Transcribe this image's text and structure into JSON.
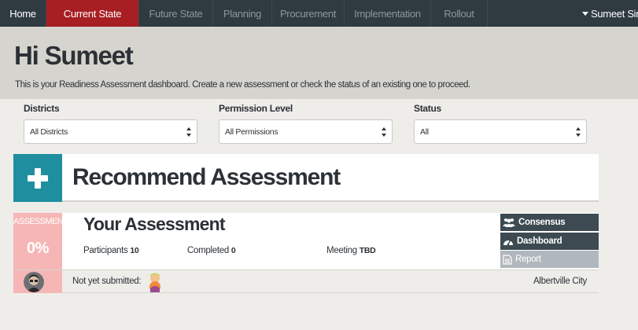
{
  "nav": {
    "tabs": [
      {
        "label": "Home"
      },
      {
        "label": "Current State"
      },
      {
        "label": "Future State"
      },
      {
        "label": "Planning"
      },
      {
        "label": "Procurement"
      },
      {
        "label": "Implementation"
      },
      {
        "label": "Rollout"
      }
    ],
    "active_tab": "Current State",
    "user": "Sumeet Sing"
  },
  "header": {
    "greeting": "Hi Sumeet",
    "intro": "This is your Readiness Assessment dashboard. Create a new assessment or check the status of an existing one to proceed."
  },
  "filters": {
    "districts": {
      "label": "Districts",
      "value": "All Districts"
    },
    "permission": {
      "label": "Permission Level",
      "value": "All Permissions"
    },
    "status": {
      "label": "Status",
      "value": "All"
    }
  },
  "recommend": {
    "title": "Recommend Assessment"
  },
  "assessment": {
    "badge_label": "ASSESSMENT",
    "percent": "0%",
    "title": "Your Assessment",
    "participants_label": "Participants",
    "participants_value": "10",
    "completed_label": "Completed",
    "completed_value": "0",
    "meeting_label": "Meeting",
    "meeting_value": "TBD",
    "actions": {
      "consensus": "Consensus",
      "dashboard": "Dashboard",
      "report": "Report"
    },
    "not_submitted_label": "Not yet submitted:",
    "district": "Albertville City"
  },
  "colors": {
    "nav_bg": "#2f3a41",
    "active_tab": "#a71e23",
    "header_bg": "#d6d4ce",
    "teal": "#1f8fa0",
    "pink": "#f6b6b6",
    "action_dark": "#3d4a52",
    "action_disabled": "#b1b8bd"
  }
}
